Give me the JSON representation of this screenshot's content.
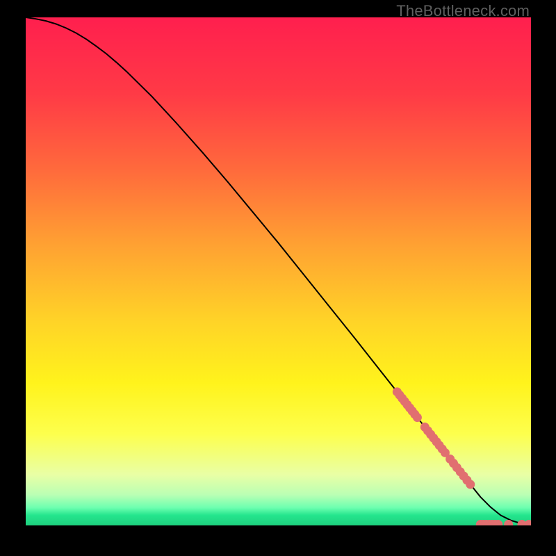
{
  "watermark": "TheBottleneck.com",
  "chart_data": {
    "type": "line",
    "title": "",
    "xlabel": "",
    "ylabel": "",
    "xlim": [
      0,
      100
    ],
    "ylim": [
      0,
      100
    ],
    "curve": {
      "x": [
        0,
        2,
        4,
        6,
        8,
        10,
        12,
        14,
        16,
        18,
        20,
        25,
        30,
        35,
        40,
        45,
        50,
        55,
        60,
        65,
        70,
        75,
        80,
        85,
        90,
        92,
        94,
        96,
        98,
        100
      ],
      "y": [
        100,
        99.7,
        99.3,
        98.7,
        97.9,
        96.9,
        95.7,
        94.3,
        92.8,
        91.1,
        89.3,
        84.4,
        79.0,
        73.4,
        67.6,
        61.6,
        55.6,
        49.4,
        43.2,
        37.0,
        30.7,
        24.4,
        18.1,
        11.8,
        5.6,
        3.6,
        2.0,
        1.0,
        0.4,
        0.2
      ]
    },
    "point_clusters": [
      {
        "x_start": 73.5,
        "x_end": 77.5,
        "count": 9,
        "on_curve": true,
        "color": "#e16f70",
        "size": 13
      },
      {
        "x_start": 79.0,
        "x_end": 83.0,
        "count": 8,
        "on_curve": true,
        "color": "#e16f70",
        "size": 13
      },
      {
        "x_start": 84.0,
        "x_end": 88.0,
        "count": 7,
        "on_curve": true,
        "color": "#e16f70",
        "size": 13
      },
      {
        "x_start": 90.0,
        "x_end": 93.5,
        "count": 7,
        "on_curve": false,
        "y": 0.2,
        "color": "#e16f70",
        "size": 13
      },
      {
        "x_start": 95.3,
        "x_end": 95.8,
        "count": 1,
        "on_curve": false,
        "y": 0.2,
        "color": "#e16f70",
        "size": 13
      },
      {
        "x_start": 98.2,
        "x_end": 99.6,
        "count": 2,
        "on_curve": false,
        "y": 0.2,
        "color": "#e16f70",
        "size": 13
      }
    ],
    "gradient_stops": [
      {
        "offset": 0.0,
        "color": "#ff1f4e"
      },
      {
        "offset": 0.15,
        "color": "#ff3a46"
      },
      {
        "offset": 0.3,
        "color": "#ff6a3c"
      },
      {
        "offset": 0.45,
        "color": "#ffa232"
      },
      {
        "offset": 0.6,
        "color": "#ffd427"
      },
      {
        "offset": 0.72,
        "color": "#fff31c"
      },
      {
        "offset": 0.82,
        "color": "#fdff4d"
      },
      {
        "offset": 0.9,
        "color": "#e9ffa5"
      },
      {
        "offset": 0.94,
        "color": "#baffb4"
      },
      {
        "offset": 0.965,
        "color": "#6dffb0"
      },
      {
        "offset": 0.98,
        "color": "#24e58d"
      },
      {
        "offset": 1.0,
        "color": "#1ed17f"
      }
    ]
  }
}
